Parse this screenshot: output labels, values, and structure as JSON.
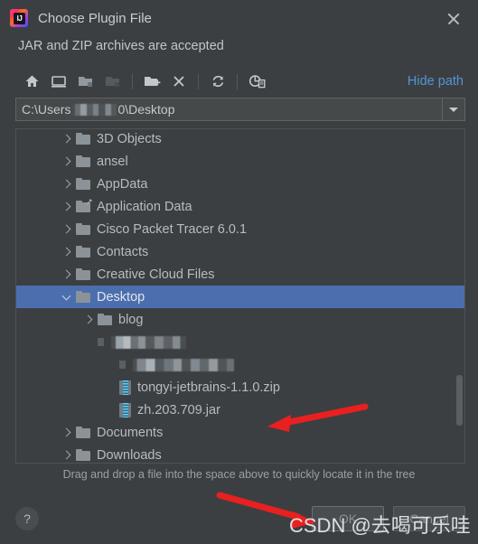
{
  "window": {
    "title": "Choose Plugin File",
    "subtitle": "JAR and ZIP archives are accepted",
    "logo_text": "IJ",
    "close_label": "×"
  },
  "toolbar": {
    "icons": [
      {
        "name": "home-icon",
        "tip": "Home"
      },
      {
        "name": "desktop-icon",
        "tip": "Desktop"
      },
      {
        "name": "expand-folder-icon",
        "tip": "Expand"
      },
      {
        "name": "collapse-folder-icon",
        "tip": "Collapse"
      },
      {
        "name": "new-folder-icon",
        "tip": "New Folder"
      },
      {
        "name": "delete-icon",
        "tip": "Delete"
      },
      {
        "name": "refresh-icon",
        "tip": "Refresh"
      },
      {
        "name": "show-hidden-files-icon",
        "tip": "Show Hidden Files"
      }
    ],
    "hide_path_label": "Hide path"
  },
  "path_field": {
    "prefix": "C:\\Users",
    "redacted": true,
    "suffix": "0\\Desktop",
    "full_value": "C:\\Users\\█████0\\Desktop"
  },
  "tree": {
    "items": [
      {
        "label": "3D Objects",
        "icon": "folder",
        "indent": 2,
        "chevron": "right",
        "selected": false
      },
      {
        "label": "ansel",
        "icon": "folder",
        "indent": 2,
        "chevron": "right",
        "selected": false
      },
      {
        "label": "AppData",
        "icon": "folder",
        "indent": 2,
        "chevron": "right",
        "selected": false
      },
      {
        "label": "Application Data",
        "icon": "folder-link",
        "indent": 2,
        "chevron": "right",
        "selected": false
      },
      {
        "label": "Cisco Packet Tracer 6.0.1",
        "icon": "folder",
        "indent": 2,
        "chevron": "right",
        "selected": false
      },
      {
        "label": "Contacts",
        "icon": "folder",
        "indent": 2,
        "chevron": "right",
        "selected": false
      },
      {
        "label": "Creative Cloud Files",
        "icon": "folder",
        "indent": 2,
        "chevron": "right",
        "selected": false
      },
      {
        "label": "Desktop",
        "icon": "folder",
        "indent": 2,
        "chevron": "down",
        "selected": true
      },
      {
        "label": "blog",
        "icon": "folder",
        "indent": 3,
        "chevron": "right",
        "selected": false
      },
      {
        "label": "",
        "icon": "redacted-a",
        "indent": 3,
        "chevron": "none",
        "selected": false
      },
      {
        "label": "",
        "icon": "redacted-b",
        "indent": 4,
        "chevron": "none",
        "selected": false
      },
      {
        "label": "tongyi-jetbrains-1.1.0.zip",
        "icon": "archive",
        "indent": 4,
        "chevron": "none",
        "selected": false
      },
      {
        "label": "zh.203.709.jar",
        "icon": "archive",
        "indent": 4,
        "chevron": "none",
        "selected": false
      },
      {
        "label": "Documents",
        "icon": "folder",
        "indent": 2,
        "chevron": "right",
        "selected": false
      },
      {
        "label": "Downloads",
        "icon": "folder",
        "indent": 2,
        "chevron": "right",
        "selected": false
      }
    ]
  },
  "hint": "Drag and drop a file into the space above to quickly locate it in the tree",
  "footer": {
    "help_label": "?",
    "ok_label": "OK",
    "cancel_label": "Cancel"
  },
  "annotations": {
    "watermark": "CSDN @去喝可乐哇",
    "arrow_color": "#e8201f",
    "arrows": [
      {
        "name": "arrow-to-jar-file",
        "points_to": "zh.203.709.jar"
      },
      {
        "name": "arrow-to-ok-button",
        "points_to": "OK"
      }
    ]
  },
  "colors": {
    "background": "#3c3f41",
    "selection": "#4b6eaf",
    "link": "#5294d6",
    "text": "#b8bcbf",
    "accent_red": "#e8201f"
  }
}
